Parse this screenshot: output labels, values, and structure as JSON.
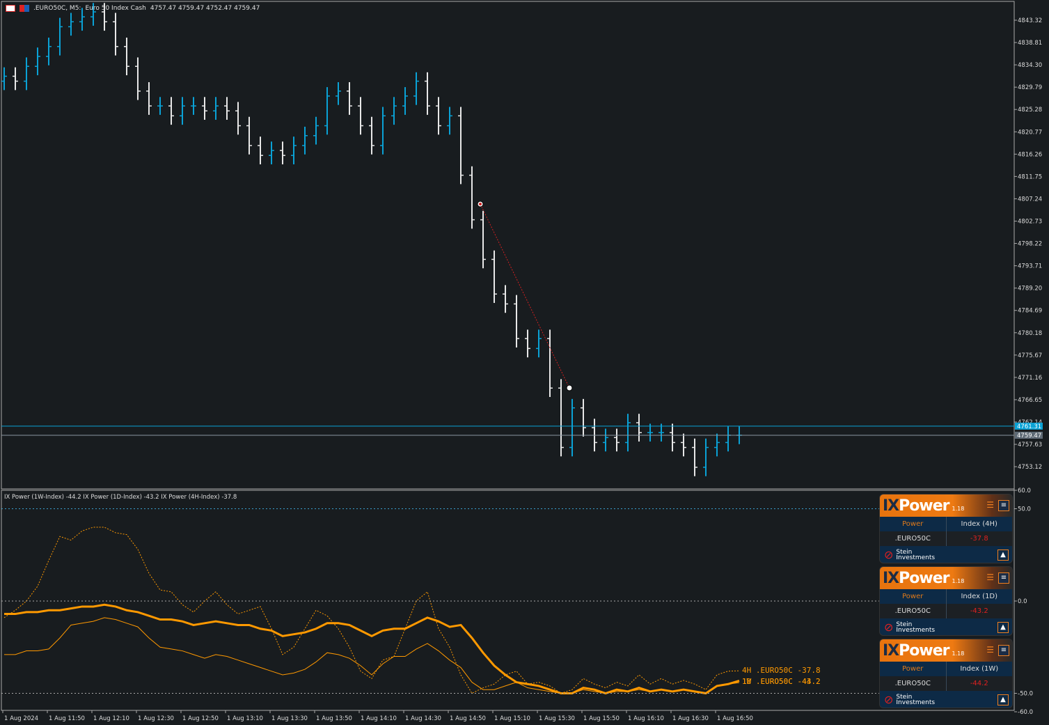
{
  "header": {
    "symbol": ".EURO50C, M5:",
    "description": "Euro 50 Index Cash",
    "ohlc": "4757.47 4759.47 4752.47 4759.47"
  },
  "price_axis": [
    "4843.32",
    "4838.81",
    "4834.30",
    "4829.79",
    "4825.28",
    "4820.77",
    "4816.26",
    "4811.75",
    "4807.24",
    "4802.73",
    "4798.22",
    "4793.71",
    "4789.20",
    "4784.69",
    "4780.18",
    "4775.67",
    "4771.16",
    "4766.65",
    "4762.14",
    "4757.63",
    "4753.12"
  ],
  "price_tags": {
    "bid": "4761.31",
    "last": "4759.47",
    "bid_color": "#0aa2d6",
    "last_color": "#5f6b76"
  },
  "time_axis": [
    "1 Aug 2024",
    "1 Aug 11:50",
    "1 Aug 12:10",
    "1 Aug 12:30",
    "1 Aug 12:50",
    "1 Aug 13:10",
    "1 Aug 13:30",
    "1 Aug 13:50",
    "1 Aug 14:10",
    "1 Aug 14:30",
    "1 Aug 14:50",
    "1 Aug 15:10",
    "1 Aug 15:30",
    "1 Aug 15:50",
    "1 Aug 16:10",
    "1 Aug 16:30",
    "1 Aug 16:50"
  ],
  "chart_data": {
    "type": "ohlc",
    "up_color": "#0aa2d6",
    "down_color": "#e8e8e8",
    "close": [
      4832,
      4831,
      4834,
      4836,
      4838,
      4842,
      4843,
      4844,
      4845,
      4843,
      4838,
      4834,
      4829,
      4826,
      4826,
      4824,
      4826,
      4826,
      4825,
      4826,
      4825,
      4822,
      4818,
      4816,
      4817,
      4816,
      4818,
      4820,
      4822,
      4828,
      4829,
      4826,
      4822,
      4818,
      4824,
      4826,
      4828,
      4831,
      4826,
      4822,
      4824,
      4812,
      4803,
      4795,
      4788,
      4786,
      4779,
      4777,
      4779,
      4769,
      4757,
      4765,
      4761,
      4758,
      4759,
      4758,
      4762,
      4760,
      4760,
      4760,
      4758,
      4757,
      4753,
      4757,
      4758,
      4759.47,
      4759.47
    ]
  },
  "indicator": {
    "title": "IX Power (1W-Index) -44.2 IX Power (1D-Index) -43.2 IX Power (4H-Index) -37.8",
    "axis": [
      "60.0",
      "50.0",
      "0.0",
      "-50.0",
      "-60.0"
    ],
    "color": "#ff9900",
    "series": [
      {
        "name": "4H .EURO50C -37.8",
        "values": [
          -9,
          -5,
          0,
          8,
          22,
          35,
          33,
          38,
          40,
          40,
          37,
          36,
          28,
          15,
          6,
          5,
          -2,
          -6,
          0,
          5,
          -2,
          -7,
          -5,
          -3,
          -15,
          -29,
          -25,
          -15,
          -5,
          -8,
          -15,
          -25,
          -38,
          -42,
          -32,
          -30,
          -15,
          0,
          5,
          -15,
          -25,
          -40,
          -50,
          -47,
          -45,
          -40,
          -38,
          -45,
          -44,
          -46,
          -50,
          -48,
          -42,
          -45,
          -47,
          -44,
          -46,
          -40,
          -45,
          -42,
          -45,
          -43,
          -45,
          -48,
          -40,
          -38,
          -37.8
        ]
      },
      {
        "name": "1D .EURO50C -43.2",
        "values": [
          -7,
          -7,
          -6,
          -6,
          -5,
          -5,
          -4,
          -3,
          -3,
          -2,
          -3,
          -5,
          -6,
          -8,
          -10,
          -10,
          -11,
          -13,
          -12,
          -11,
          -12,
          -13,
          -13,
          -15,
          -16,
          -19,
          -18,
          -17,
          -15,
          -12,
          -12,
          -13,
          -16,
          -19,
          -16,
          -15,
          -15,
          -12,
          -9,
          -11,
          -14,
          -13,
          -20,
          -28,
          -35,
          -40,
          -44,
          -45,
          -46,
          -48,
          -50,
          -50,
          -47,
          -48,
          -50,
          -48,
          -49,
          -47,
          -49,
          -48,
          -49,
          -48,
          -49,
          -50,
          -46,
          -45,
          -43.2
        ]
      },
      {
        "name": "1W .EURO50C -44.2",
        "values": [
          -29,
          -29,
          -27,
          -27,
          -26,
          -20,
          -13,
          -12,
          -11,
          -9,
          -10,
          -12,
          -14,
          -20,
          -25,
          -26,
          -27,
          -29,
          -31,
          -29,
          -30,
          -32,
          -34,
          -36,
          -38,
          -40,
          -39,
          -37,
          -33,
          -28,
          -29,
          -31,
          -35,
          -40,
          -34,
          -30,
          -30,
          -26,
          -23,
          -27,
          -32,
          -36,
          -44,
          -48,
          -48,
          -46,
          -44,
          -47,
          -48,
          -49,
          -50,
          -50,
          -48,
          -49,
          -50,
          -49,
          -49,
          -48,
          -49,
          -48,
          -49,
          -48,
          -49,
          -50,
          -46,
          -45,
          -44.2
        ]
      }
    ]
  },
  "widgets": [
    {
      "logo_ix": "IX",
      "logo_power": "Power",
      "version": "1.18",
      "col1": "Power",
      "col2": "Index (4H)",
      "symbol": ".EURO50C",
      "value": "-37.8",
      "brand1": "Stein",
      "brand2": "Investments"
    },
    {
      "logo_ix": "IX",
      "logo_power": "Power",
      "version": "1.18",
      "col1": "Power",
      "col2": "Index (1D)",
      "symbol": ".EURO50C",
      "value": "-43.2",
      "brand1": "Stein",
      "brand2": "Investments"
    },
    {
      "logo_ix": "IX",
      "logo_power": "Power",
      "version": "1.18",
      "col1": "Power",
      "col2": "Index (1W)",
      "symbol": ".EURO50C",
      "value": "-44.2",
      "brand1": "Stein",
      "brand2": "Investments"
    }
  ]
}
